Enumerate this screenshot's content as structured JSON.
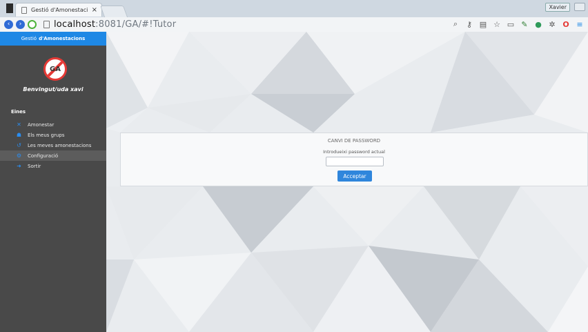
{
  "browser": {
    "tab_title": "Gestió d'Amonestacions E",
    "tab_close": "×",
    "profile_label": "Xavier",
    "url_host": "localhost",
    "url_rest": ":8081/GA/#!Tutor"
  },
  "sidebar": {
    "header_prefix": "Gestió",
    "header_bold": "d'Amonestacions",
    "logo_text": "GA",
    "welcome": "Benvingut/uda xavi",
    "section_title": "Eines",
    "items": [
      {
        "label": "Amonestar",
        "icon": "x-icon"
      },
      {
        "label": "Els meus grups",
        "icon": "users-icon"
      },
      {
        "label": "Les meves amonestacions",
        "icon": "history-icon"
      },
      {
        "label": "Configuració",
        "icon": "gear-icon"
      },
      {
        "label": "Sortir",
        "icon": "logout-icon"
      }
    ],
    "active_index": 3
  },
  "panel": {
    "title": "CANVI DE PASSWORD",
    "field_label": "Introdueixi password actual",
    "field_value": "",
    "button_label": "Acceptar"
  },
  "colors": {
    "accent": "#1e88e5",
    "sidebar_bg": "#494949",
    "logo_red": "#e53935"
  }
}
